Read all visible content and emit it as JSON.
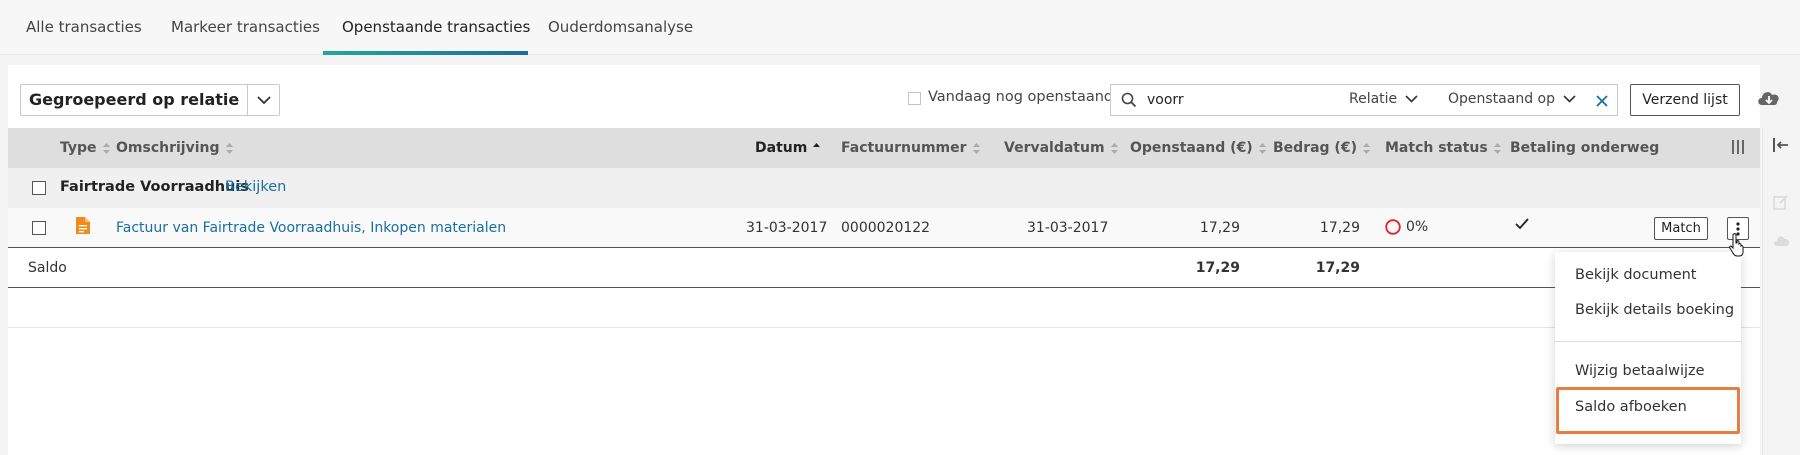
{
  "tabs": [
    {
      "label": "Alle transacties"
    },
    {
      "label": "Markeer transacties"
    },
    {
      "label": "Openstaande transacties"
    },
    {
      "label": "Ouderdomsanalyse"
    }
  ],
  "toolbar": {
    "group_label": "Gegroepeerd op relatie",
    "today_label": "Vandaag nog openstaand",
    "search_value": "voorr",
    "filter_relatie": "Relatie",
    "filter_openstaand": "Openstaand op",
    "send_label": "Verzend lijst"
  },
  "table": {
    "headers": {
      "type": "Type",
      "omschrijving": "Omschrijving",
      "datum": "Datum",
      "factuurnummer": "Factuurnummer",
      "vervaldatum": "Vervaldatum",
      "openstaand": "Openstaand (€)",
      "bedrag": "Bedrag (€)",
      "match_status": "Match status",
      "betaling": "Betaling onderweg"
    },
    "group": {
      "name": "Fairtrade Voorraadhuis",
      "link": "Bekijken"
    },
    "row": {
      "omschrijving": "Factuur van Fairtrade Voorraadhuis, Inkopen materialen",
      "datum": "31-03-2017",
      "factuurnummer": "0000020122",
      "vervaldatum": "31-03-2017",
      "openstaand": "17,29",
      "bedrag": "17,29",
      "match_pct": "0%",
      "match_label": "Match"
    },
    "saldo": {
      "label": "Saldo",
      "openstaand": "17,29",
      "bedrag": "17,29"
    }
  },
  "menu": {
    "items": [
      {
        "label": "Bekijk document"
      },
      {
        "label": "Bekijk details boeking"
      },
      {
        "label": "Wijzig betaalwijze"
      },
      {
        "label": "Saldo afboeken"
      }
    ]
  },
  "colors": {
    "accent": "#1a6fa0",
    "tab_underline": "#27a69a",
    "highlight": "#e87d3e",
    "doc_icon": "#f08c1e",
    "match_ring": "#e0242b"
  }
}
